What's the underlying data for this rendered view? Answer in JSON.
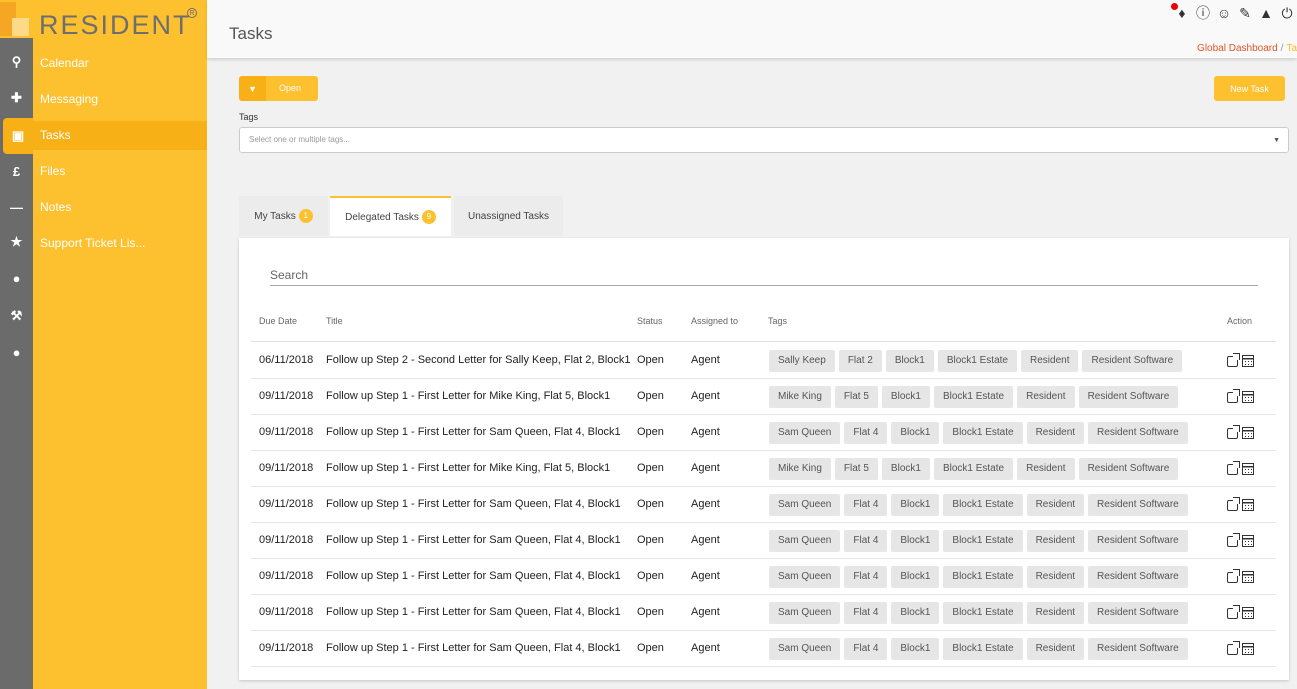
{
  "brand": {
    "name": "RESIDENT",
    "reg": "R"
  },
  "nav": [
    {
      "label": "Calendar",
      "icon": "search-icon",
      "glyph": "⚲"
    },
    {
      "label": "Messaging",
      "icon": "plus-icon",
      "glyph": "✚"
    },
    {
      "label": "Tasks",
      "icon": "briefcase-icon",
      "glyph": "▣"
    },
    {
      "label": "Files",
      "icon": "pound-icon",
      "glyph": "£"
    },
    {
      "label": "Notes",
      "icon": "minus-icon",
      "glyph": "—"
    },
    {
      "label": "Support Ticket Lis...",
      "icon": "star-icon",
      "glyph": "★"
    }
  ],
  "extra_rail_icons": [
    "lightbulb-icon",
    "wrench-icon",
    "user-icon"
  ],
  "header": {
    "title": "Tasks",
    "breadcrumb": [
      "Global Dashboard",
      "/",
      "Ta"
    ]
  },
  "toolbar": {
    "filter_label": "Open",
    "new_task_label": "New Task",
    "tags_label": "Tags",
    "tags_placeholder": "Select one or multiple tags..."
  },
  "tabs": [
    {
      "label": "My Tasks",
      "count": "1"
    },
    {
      "label": "Delegated Tasks",
      "count": "9"
    },
    {
      "label": "Unassigned Tasks",
      "count": ""
    }
  ],
  "search_placeholder": "Search",
  "columns": [
    "Due Date",
    "Title",
    "Status",
    "Assigned to",
    "Tags",
    "Action"
  ],
  "rows": [
    {
      "due": "06/11/2018",
      "title": "Follow up Step 2 - Second Letter for Sally Keep, Flat 2, Block1",
      "status": "Open",
      "assigned": "Agent",
      "tags": [
        "Sally Keep",
        "Flat 2",
        "Block1",
        "Block1 Estate",
        "Resident",
        "Resident Software"
      ]
    },
    {
      "due": "09/11/2018",
      "title": "Follow up Step 1 - First Letter for Mike King, Flat 5, Block1",
      "status": "Open",
      "assigned": "Agent",
      "tags": [
        "Mike King",
        "Flat 5",
        "Block1",
        "Block1 Estate",
        "Resident",
        "Resident Software"
      ]
    },
    {
      "due": "09/11/2018",
      "title": "Follow up Step 1 - First Letter for Sam Queen, Flat 4, Block1",
      "status": "Open",
      "assigned": "Agent",
      "tags": [
        "Sam Queen",
        "Flat 4",
        "Block1",
        "Block1 Estate",
        "Resident",
        "Resident Software"
      ]
    },
    {
      "due": "09/11/2018",
      "title": "Follow up Step 1 - First Letter for Mike King, Flat 5, Block1",
      "status": "Open",
      "assigned": "Agent",
      "tags": [
        "Mike King",
        "Flat 5",
        "Block1",
        "Block1 Estate",
        "Resident",
        "Resident Software"
      ]
    },
    {
      "due": "09/11/2018",
      "title": "Follow up Step 1 - First Letter for Sam Queen, Flat 4, Block1",
      "status": "Open",
      "assigned": "Agent",
      "tags": [
        "Sam Queen",
        "Flat 4",
        "Block1",
        "Block1 Estate",
        "Resident",
        "Resident Software"
      ]
    },
    {
      "due": "09/11/2018",
      "title": "Follow up Step 1 - First Letter for Sam Queen, Flat 4, Block1",
      "status": "Open",
      "assigned": "Agent",
      "tags": [
        "Sam Queen",
        "Flat 4",
        "Block1",
        "Block1 Estate",
        "Resident",
        "Resident Software"
      ]
    },
    {
      "due": "09/11/2018",
      "title": "Follow up Step 1 - First Letter for Sam Queen, Flat 4, Block1",
      "status": "Open",
      "assigned": "Agent",
      "tags": [
        "Sam Queen",
        "Flat 4",
        "Block1",
        "Block1 Estate",
        "Resident",
        "Resident Software"
      ]
    },
    {
      "due": "09/11/2018",
      "title": "Follow up Step 1 - First Letter for Sam Queen, Flat 4, Block1",
      "status": "Open",
      "assigned": "Agent",
      "tags": [
        "Sam Queen",
        "Flat 4",
        "Block1",
        "Block1 Estate",
        "Resident",
        "Resident Software"
      ]
    },
    {
      "due": "09/11/2018",
      "title": "Follow up Step 1 - First Letter for Sam Queen, Flat 4, Block1",
      "status": "Open",
      "assigned": "Agent",
      "tags": [
        "Sam Queen",
        "Flat 4",
        "Block1",
        "Block1 Estate",
        "Resident",
        "Resident Software"
      ]
    }
  ],
  "colors": {
    "accent": "#fdc02f",
    "accent_dark": "#f8b017",
    "rail": "#6b6b6b"
  }
}
